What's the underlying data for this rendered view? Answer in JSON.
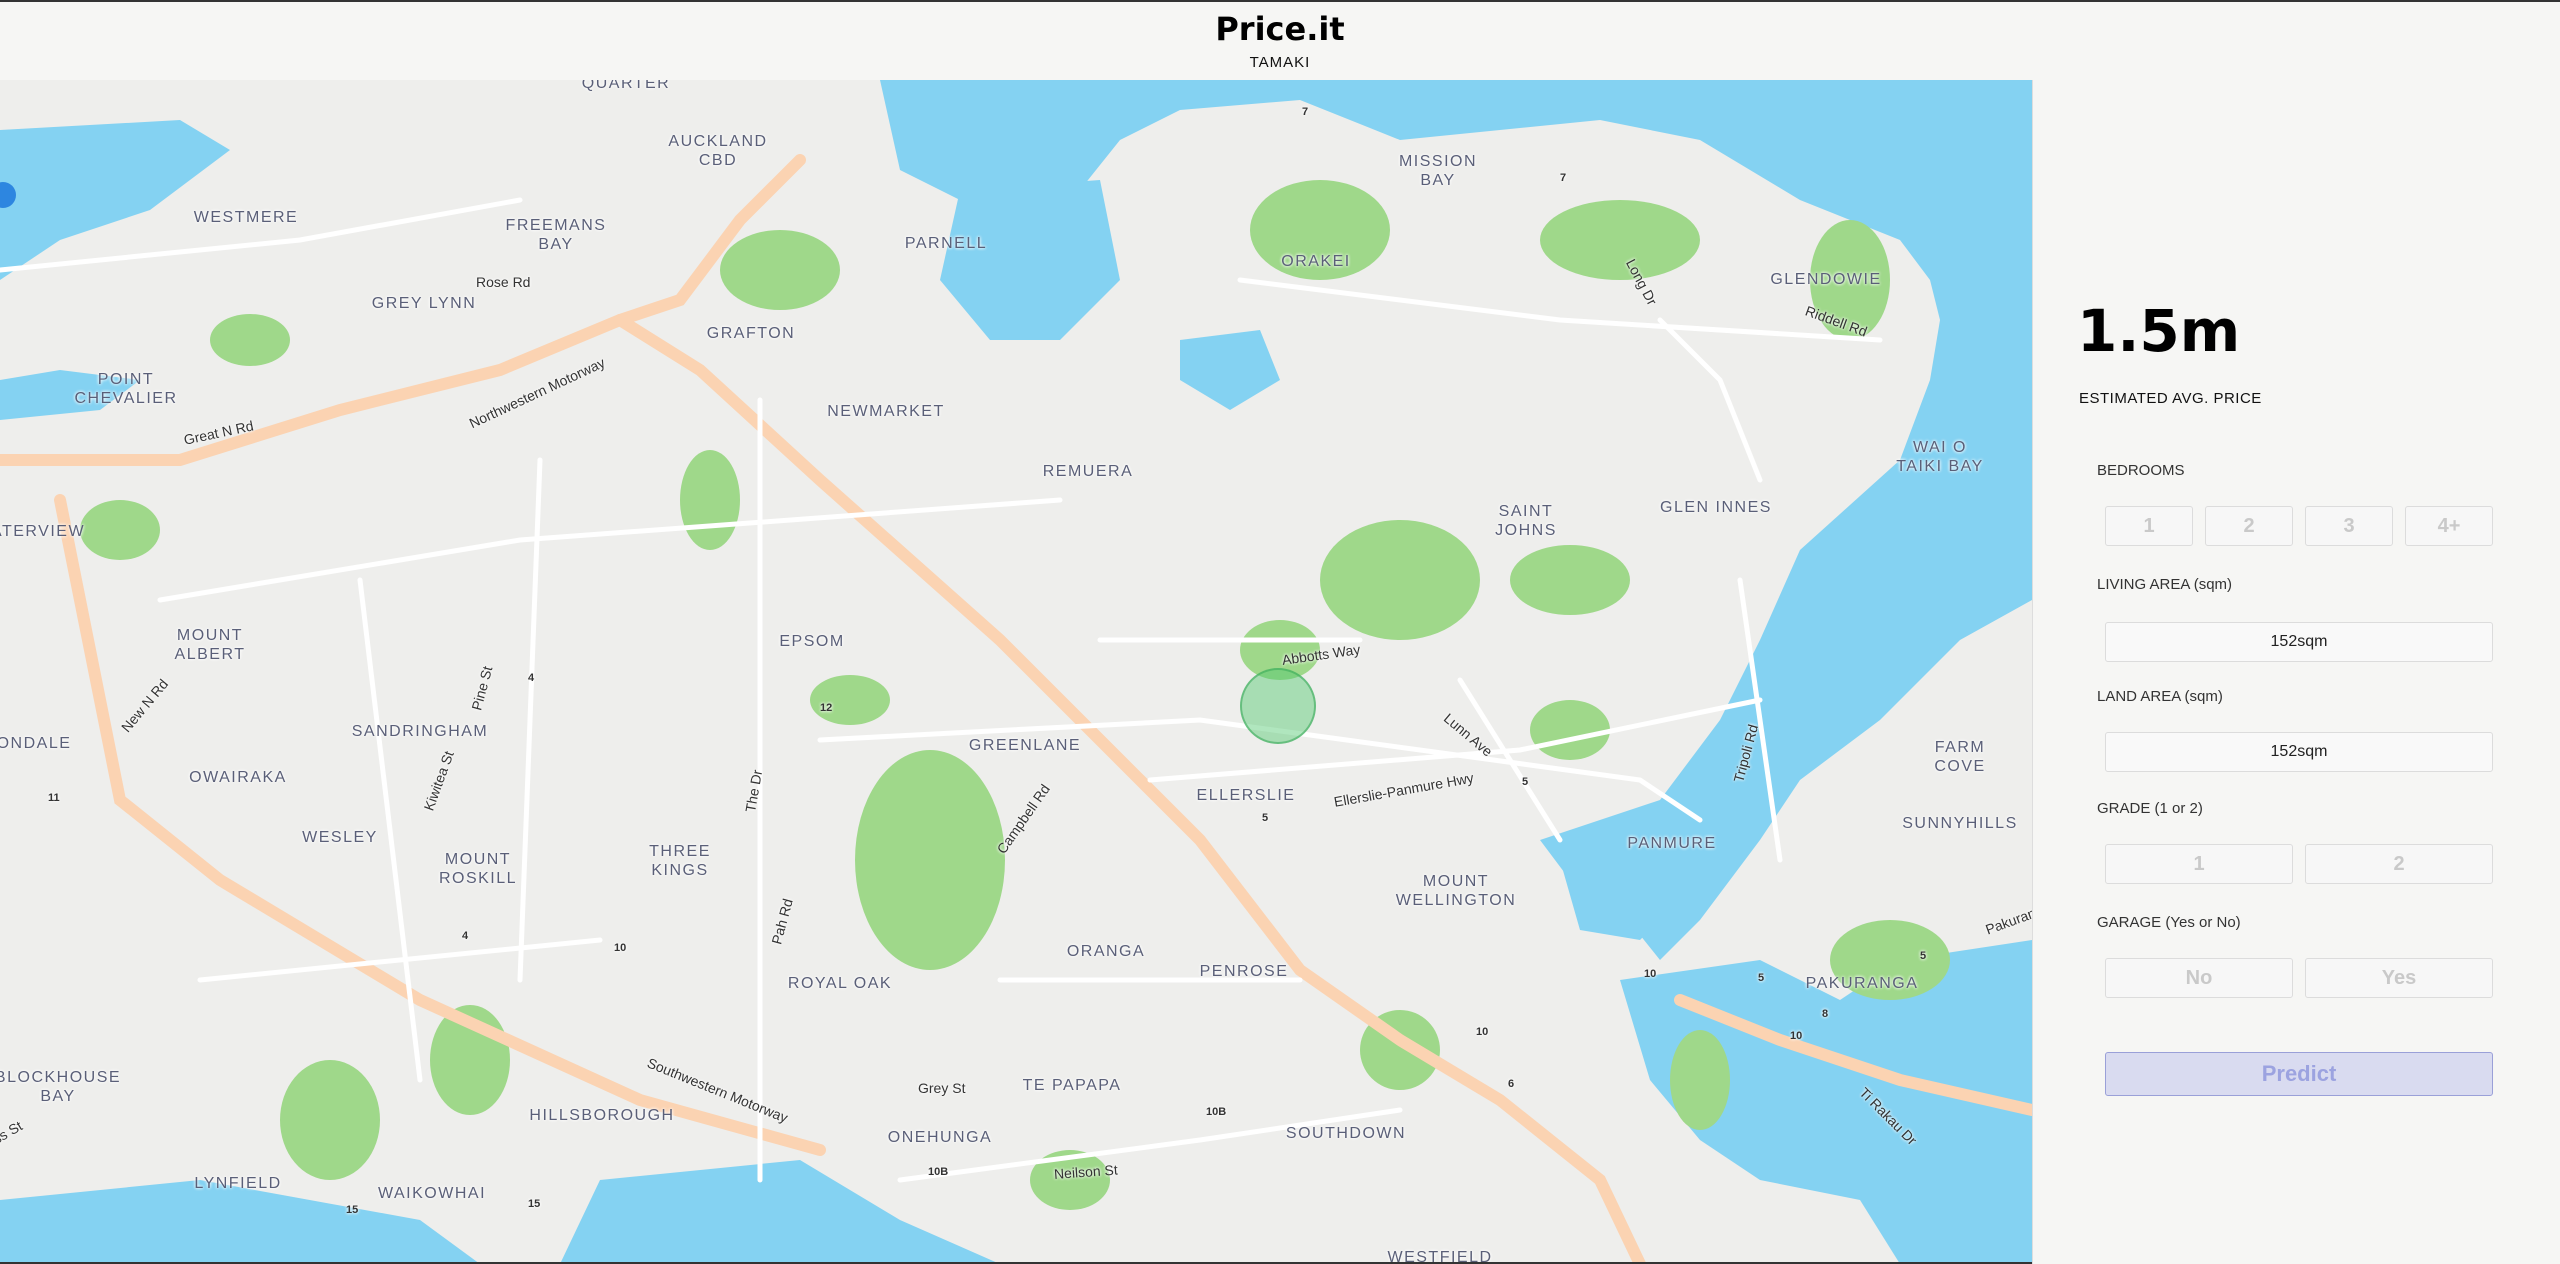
{
  "header": {
    "title": "Price.it",
    "subtitle": "TAMAKI"
  },
  "map": {
    "colors": {
      "water": "#84d2f2",
      "land": "#eeeeec",
      "park": "#9fd88a",
      "motorway": "#fbd3b2"
    },
    "suburbs": [
      "QUARTER",
      "AUCKLAND\nCBD",
      "WESTMERE",
      "FREEMANS\nBAY",
      "PARNELL",
      "MISSION\nBAY",
      "ORAKEI",
      "GLENDOWIE",
      "GREY LYNN",
      "GRAFTON",
      "POINT\nCHEVALIER",
      "NEWMARKET",
      "REMUERA",
      "SAINT\nJOHNS",
      "GLEN INNES",
      "WAI O\nTAIKI BAY",
      "ATERVIEW",
      "MOUNT\nALBERT",
      "EPSOM",
      "SANDRINGHAM",
      "GREENLANE",
      "ELLERSLIE",
      "FARM COVE",
      "ONDALE",
      "OWAIRAKA",
      "SUNNYHILLS",
      "WESLEY",
      "MOUNT\nROSKILL",
      "THREE\nKINGS",
      "MOUNT\nWELLINGTON",
      "PANMURE",
      "ORANGA",
      "PENROSE",
      "ROYAL OAK",
      "PAKURANGA",
      "BLOCKHOUSE\nBAY",
      "TE PAPAPA",
      "HILLSBOROUGH",
      "ONEHUNGA",
      "SOUTHDOWN",
      "LYNFIELD",
      "WAIKOWHAI",
      "WESTFIELD"
    ],
    "roads": [
      "Rose Rd",
      "Great N Rd",
      "Northwestern Motorway",
      "Long Dr",
      "Riddell Rd",
      "Abbotts Way",
      "Lunn Ave",
      "Ellerslie-Panmure Hwy",
      "Tripoli Rd",
      "New N Rd",
      "Pine St",
      "Kiwitea St",
      "The Dr",
      "Campbell Rd",
      "Pah Rd",
      "Grey St",
      "Southwestern Motorway",
      "Neilson St",
      "Ti Rakau Dr",
      "Pakuranga",
      "ss St"
    ],
    "route_numbers": [
      "7",
      "7",
      "12",
      "4",
      "5",
      "5",
      "11",
      "4",
      "10",
      "10",
      "10",
      "5",
      "8",
      "6",
      "10B",
      "10B",
      "15",
      "15",
      "10",
      "5"
    ]
  },
  "panel": {
    "price": "1.5m",
    "price_caption": "ESTIMATED AVG. PRICE",
    "bedrooms": {
      "label": "BEDROOMS",
      "options": [
        "1",
        "2",
        "3",
        "4+"
      ]
    },
    "living_area": {
      "label": "LIVING AREA (sqm)",
      "value": "152sqm"
    },
    "land_area": {
      "label": "LAND AREA (sqm)",
      "value": "152sqm"
    },
    "grade": {
      "label": "GRADE (1 or 2)",
      "options": [
        "1",
        "2"
      ]
    },
    "garage": {
      "label": "GARAGE (Yes or No)",
      "options": [
        "No",
        "Yes"
      ]
    },
    "predict_label": "Predict"
  }
}
